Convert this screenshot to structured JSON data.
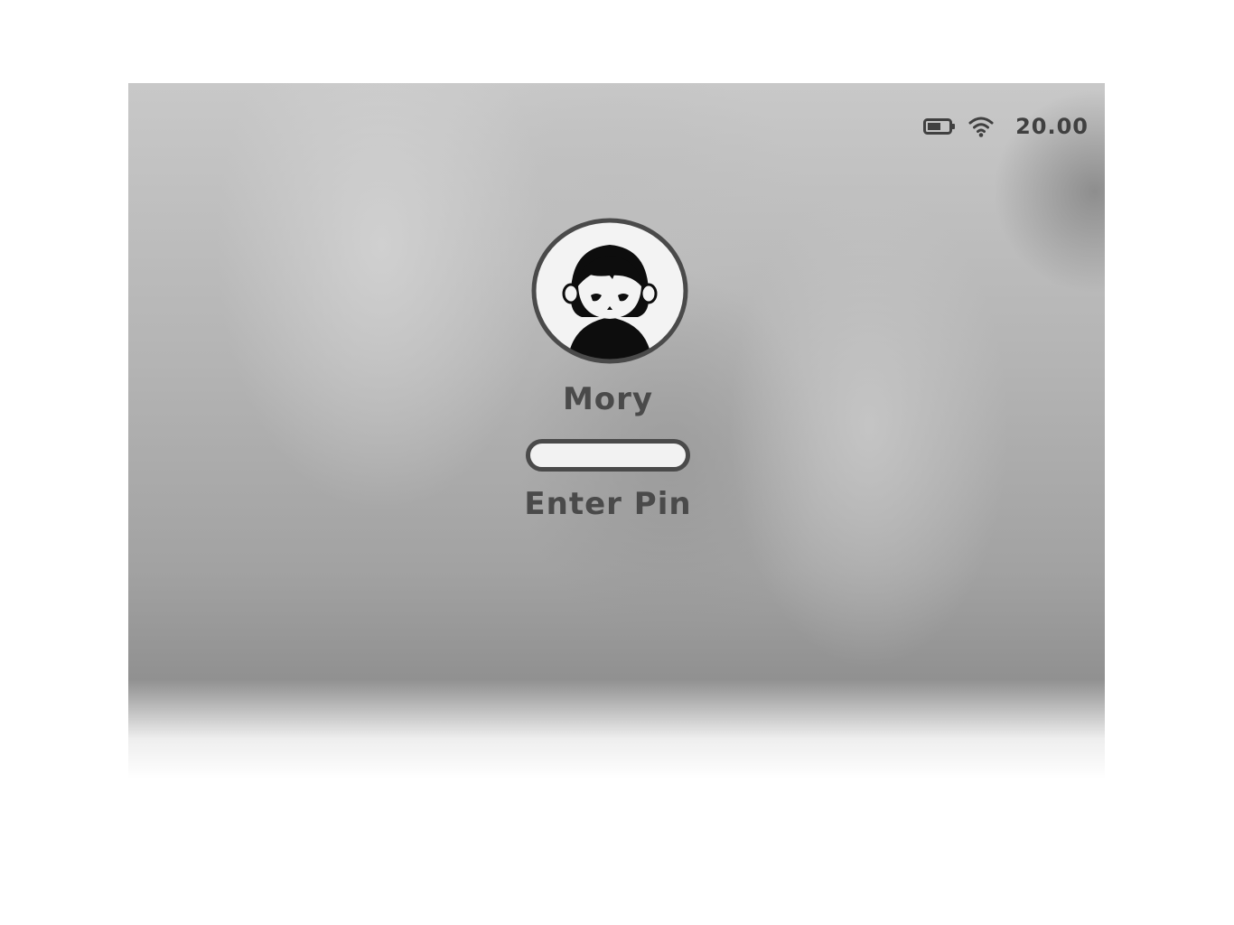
{
  "status_bar": {
    "battery_icon": "battery-icon",
    "wifi_icon": "wifi-icon",
    "time": "20.00"
  },
  "login": {
    "avatar_icon": "user-avatar",
    "user_name": "Mory",
    "pin_value": "",
    "prompt": "Enter Pin"
  },
  "colors": {
    "text": "#4a4a4a",
    "input_border": "#4a4a4a",
    "input_fill": "#f2f2f2"
  }
}
